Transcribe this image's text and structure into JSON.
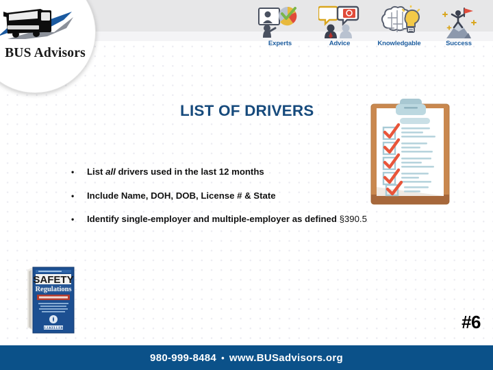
{
  "slide": {
    "page_number": "#6",
    "title": "LIST OF DRIVERS",
    "background_color": "#ffffff",
    "title_color": "#164a7c"
  },
  "brand": {
    "logo_text": "BUS Advisors",
    "logo_icon": "bus-logo-icon",
    "accent_color": "#0b5189"
  },
  "header": {
    "band_color": "#e7e7e8",
    "icons": [
      {
        "label": "Experts",
        "icon": "presenter-chart-icon"
      },
      {
        "label": "Advice",
        "icon": "speech-bubbles-people-icon"
      },
      {
        "label": "Knowledgable",
        "icon": "brain-lightbulb-icon"
      },
      {
        "label": "Success",
        "icon": "mountain-flag-icon"
      }
    ]
  },
  "content": {
    "bullet_marker": "•",
    "bullets": [
      {
        "parts": [
          {
            "text": "List ",
            "style": "bold"
          },
          {
            "text": "all",
            "style": "bold-italic"
          },
          {
            "text": " drivers used in the last 12 months",
            "style": "bold"
          }
        ],
        "plain": "List all drivers used in the last 12 months"
      },
      {
        "parts": [
          {
            "text": "Include Name, DOH, DOB, License # & State",
            "style": "bold"
          }
        ],
        "plain": "Include Name, DOH, DOB, License # & State"
      },
      {
        "parts": [
          {
            "text": "Identify single-employer and multiple-employer as defined ",
            "style": "bold"
          },
          {
            "text": "§390.5",
            "style": "regular"
          }
        ],
        "plain": "Identify single-employer and multiple-employer as defined §390.5"
      }
    ]
  },
  "graphics": {
    "clipboard": {
      "name": "clipboard-checklist-icon",
      "checkmark_count": 5,
      "board_color": "#c9884f",
      "check_color": "#e8553a",
      "line_color": "#b7d4dd"
    },
    "book": {
      "name": "safety-regulations-book-icon",
      "title_line_1": "SAFETY",
      "title_line_2": "Regulations",
      "cover_color": "#1c4f91"
    }
  },
  "footer": {
    "phone": "980-999-8484",
    "separator": "•",
    "website": "www.BUSadvisors.org",
    "bar_color": "#0b5189"
  }
}
